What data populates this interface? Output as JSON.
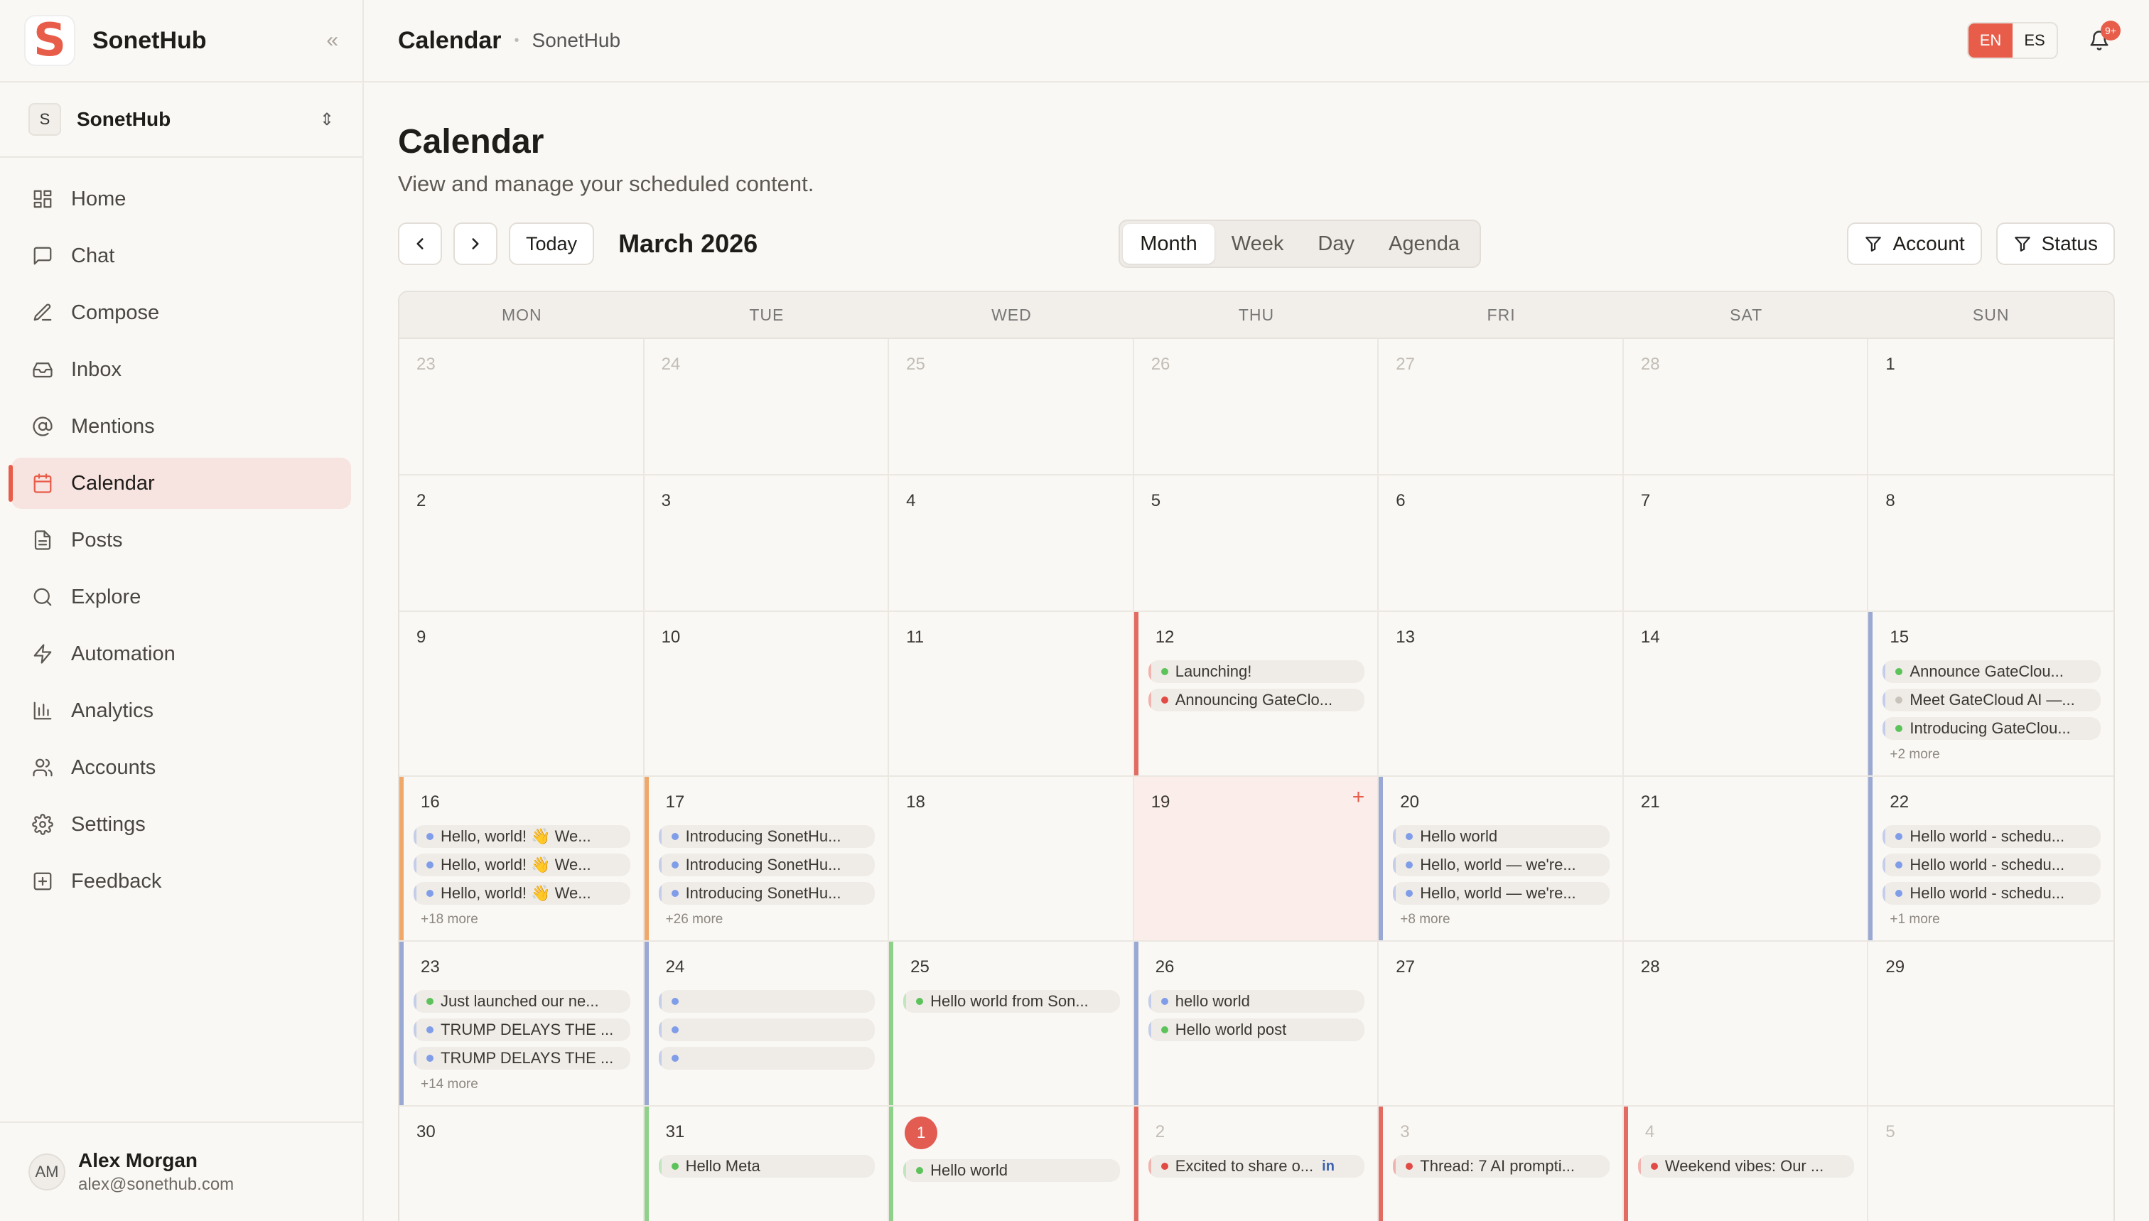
{
  "app": {
    "name": "SonetHub",
    "workspace": "SonetHub",
    "workspace_initial": "S"
  },
  "sidebar": {
    "items": [
      {
        "label": "Home",
        "icon": "grid-icon"
      },
      {
        "label": "Chat",
        "icon": "chat-icon"
      },
      {
        "label": "Compose",
        "icon": "compose-icon"
      },
      {
        "label": "Inbox",
        "icon": "inbox-icon"
      },
      {
        "label": "Mentions",
        "icon": "at-icon"
      },
      {
        "label": "Calendar",
        "icon": "calendar-icon",
        "active": true
      },
      {
        "label": "Posts",
        "icon": "file-icon"
      },
      {
        "label": "Explore",
        "icon": "search-icon"
      },
      {
        "label": "Automation",
        "icon": "bolt-icon"
      },
      {
        "label": "Analytics",
        "icon": "chart-icon"
      },
      {
        "label": "Accounts",
        "icon": "users-icon"
      },
      {
        "label": "Settings",
        "icon": "gear-icon"
      },
      {
        "label": "Feedback",
        "icon": "feedback-icon"
      }
    ],
    "user": {
      "initials": "AM",
      "name": "Alex Morgan",
      "email": "alex@sonethub.com"
    }
  },
  "topbar": {
    "title": "Calendar",
    "sub": "SonetHub",
    "lang_en": "EN",
    "lang_es": "ES",
    "badge": "9+"
  },
  "page": {
    "title": "Calendar",
    "subtitle": "View and manage your scheduled content."
  },
  "toolbar": {
    "today": "Today",
    "month_label": "March 2026",
    "views": [
      "Month",
      "Week",
      "Day",
      "Agenda"
    ],
    "filters": [
      "Account",
      "Status"
    ]
  },
  "colors": {
    "accent": "#e85d4a",
    "green": "#5cc25a",
    "blue": "#7f9de8",
    "red": "#e24b45"
  },
  "weekdays": [
    "MON",
    "TUE",
    "WED",
    "THU",
    "FRI",
    "SAT",
    "SUN"
  ],
  "weeks": [
    {
      "days": [
        {
          "num": "23",
          "muted": true
        },
        {
          "num": "24",
          "muted": true
        },
        {
          "num": "25",
          "muted": true
        },
        {
          "num": "26",
          "muted": true
        },
        {
          "num": "27",
          "muted": true
        },
        {
          "num": "28",
          "muted": true
        },
        {
          "num": "1"
        }
      ]
    },
    {
      "days": [
        {
          "num": "2"
        },
        {
          "num": "3"
        },
        {
          "num": "4"
        },
        {
          "num": "5"
        },
        {
          "num": "6"
        },
        {
          "num": "7"
        },
        {
          "num": "8"
        }
      ]
    },
    {
      "days": [
        {
          "num": "9"
        },
        {
          "num": "10"
        },
        {
          "num": "11"
        },
        {
          "num": "12",
          "accent": "red",
          "events": [
            {
              "text": "Launching!",
              "dot": "green"
            },
            {
              "text": "Announcing GateClo...",
              "dot": "red"
            }
          ]
        },
        {
          "num": "13"
        },
        {
          "num": "14"
        },
        {
          "num": "15",
          "accent": "blue",
          "events": [
            {
              "text": "Announce GateClou...",
              "dot": "green"
            },
            {
              "text": "Meet GateCloud AI —...",
              "dot": "grey"
            },
            {
              "text": "Introducing GateClou...",
              "dot": "green"
            }
          ],
          "more": "+2 more"
        }
      ]
    },
    {
      "days": [
        {
          "num": "16",
          "accent": "orange",
          "events": [
            {
              "text": "Hello, world! 👋 We...",
              "dot": "blue"
            },
            {
              "text": "Hello, world! 👋 We...",
              "dot": "blue"
            },
            {
              "text": "Hello, world! 👋 We...",
              "dot": "blue"
            }
          ],
          "more": "+18 more"
        },
        {
          "num": "17",
          "accent": "orange",
          "events": [
            {
              "text": "Introducing SonetHu...",
              "dot": "blue"
            },
            {
              "text": "Introducing SonetHu...",
              "dot": "blue"
            },
            {
              "text": "Introducing SonetHu...",
              "dot": "blue"
            }
          ],
          "more": "+26 more"
        },
        {
          "num": "18"
        },
        {
          "num": "19",
          "hover": true,
          "plus": "+"
        },
        {
          "num": "20",
          "accent": "blue",
          "events": [
            {
              "text": "Hello world",
              "dot": "blue"
            },
            {
              "text": "Hello, world — we're...",
              "dot": "blue"
            },
            {
              "text": "Hello, world — we're...",
              "dot": "blue"
            }
          ],
          "more": "+8 more"
        },
        {
          "num": "21"
        },
        {
          "num": "22",
          "accent": "blue",
          "events": [
            {
              "text": "Hello world - schedu...",
              "dot": "blue"
            },
            {
              "text": "Hello world - schedu...",
              "dot": "blue"
            },
            {
              "text": "Hello world - schedu...",
              "dot": "blue"
            }
          ],
          "more": "+1 more"
        }
      ]
    },
    {
      "days": [
        {
          "num": "23",
          "accent": "blue",
          "events": [
            {
              "text": "Just launched our ne...",
              "dot": "green"
            },
            {
              "text": "TRUMP DELAYS THE ...",
              "dot": "blue"
            },
            {
              "text": "TRUMP DELAYS THE ...",
              "dot": "blue"
            }
          ],
          "more": "+14 more"
        },
        {
          "num": "24",
          "accent": "blue",
          "events": [
            {
              "text": "",
              "dot": "blue"
            },
            {
              "text": "",
              "dot": "blue"
            },
            {
              "text": "",
              "dot": "blue"
            }
          ]
        },
        {
          "num": "25",
          "accent": "green",
          "events": [
            {
              "text": "Hello world from Son...",
              "dot": "green"
            }
          ]
        },
        {
          "num": "26",
          "accent": "blue",
          "events": [
            {
              "text": "hello world",
              "dot": "blue"
            },
            {
              "text": "Hello world post",
              "dot": "green"
            }
          ]
        },
        {
          "num": "27"
        },
        {
          "num": "28"
        },
        {
          "num": "29"
        }
      ]
    },
    {
      "days": [
        {
          "num": "30"
        },
        {
          "num": "31",
          "accent": "green",
          "events": [
            {
              "text": "Hello Meta",
              "dot": "green"
            }
          ]
        },
        {
          "num": "1",
          "today": true,
          "accent": "green",
          "events": [
            {
              "text": "Hello world",
              "dot": "green"
            }
          ]
        },
        {
          "num": "2",
          "muted": true,
          "accent": "red",
          "events": [
            {
              "text": "Excited to share o...",
              "dot": "red",
              "li": "in"
            }
          ]
        },
        {
          "num": "3",
          "muted": true,
          "accent": "red",
          "events": [
            {
              "text": "Thread: 7 AI prompti...",
              "dot": "red"
            }
          ]
        },
        {
          "num": "4",
          "muted": true,
          "accent": "red",
          "events": [
            {
              "text": "Weekend vibes: Our ...",
              "dot": "red"
            }
          ]
        },
        {
          "num": "5",
          "muted": true
        }
      ]
    }
  ]
}
